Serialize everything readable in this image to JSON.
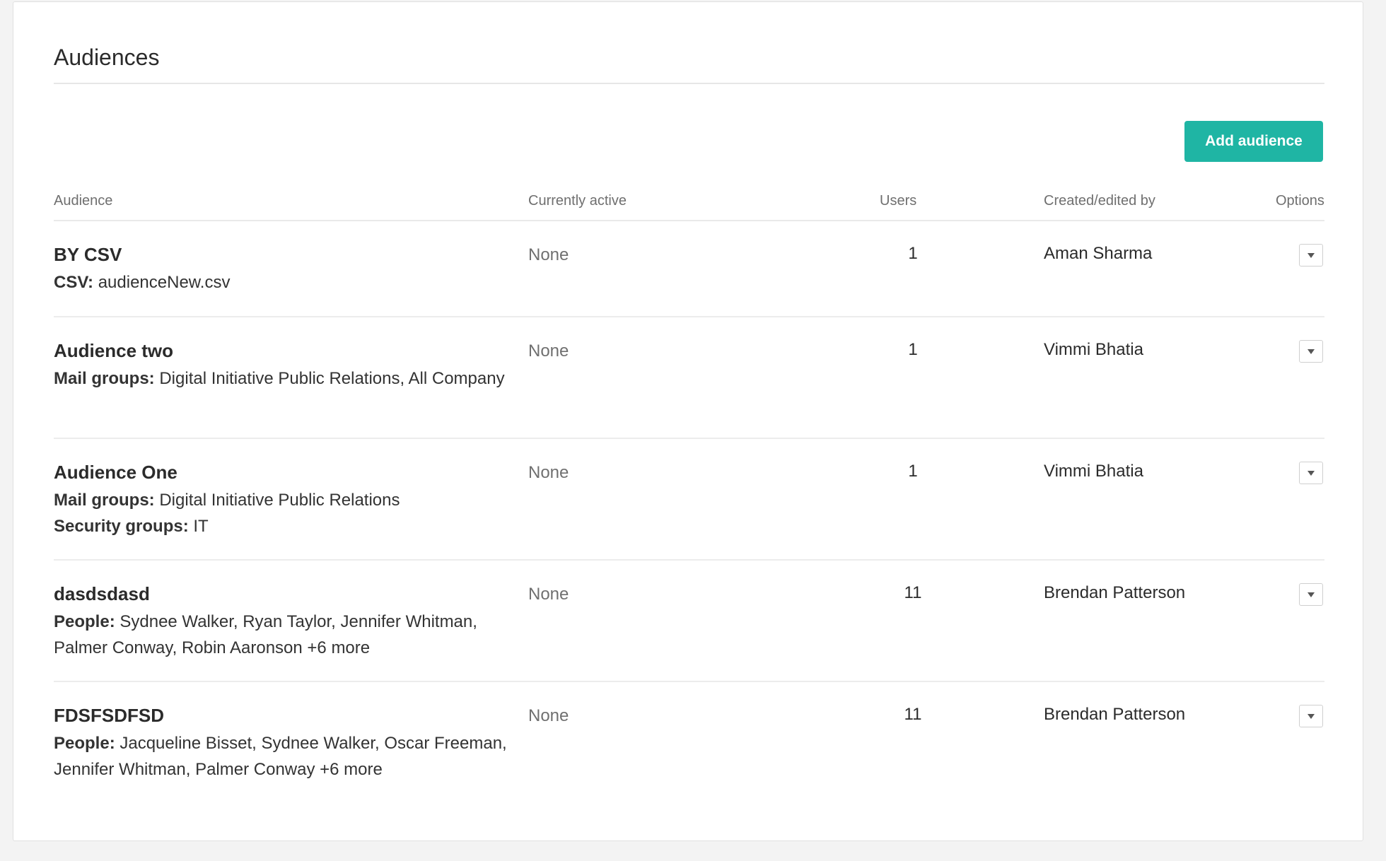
{
  "page": {
    "title": "Audiences"
  },
  "toolbar": {
    "add_label": "Add audience"
  },
  "table": {
    "headers": {
      "audience": "Audience",
      "active": "Currently active",
      "users": "Users",
      "created_by": "Created/edited by",
      "options": "Options"
    },
    "rows": [
      {
        "name": "BY CSV",
        "details": [
          {
            "label": "CSV:",
            "value": "audienceNew.csv"
          }
        ],
        "active": "None",
        "users": "1",
        "created_by": "Aman Sharma"
      },
      {
        "name": "Audience two",
        "details": [
          {
            "label": "Mail groups:",
            "value": "Digital Initiative Public Relations, All Company"
          }
        ],
        "active": "None",
        "users": "1",
        "created_by": "Vimmi Bhatia"
      },
      {
        "name": "Audience One",
        "details": [
          {
            "label": "Mail groups:",
            "value": "Digital Initiative Public Relations"
          },
          {
            "label": "Security groups:",
            "value": "IT"
          }
        ],
        "active": "None",
        "users": "1",
        "created_by": "Vimmi Bhatia"
      },
      {
        "name": "dasdsdasd",
        "details": [
          {
            "label": "People:",
            "value": "Sydnee Walker, Ryan Taylor, Jennifer Whitman, Palmer Conway, Robin Aaronson +6 more"
          }
        ],
        "active": "None",
        "users": "11",
        "created_by": "Brendan Patterson"
      },
      {
        "name": "FDSFSDFSD",
        "details": [
          {
            "label": "People:",
            "value": "Jacqueline Bisset, Sydnee Walker, Oscar Freeman, Jennifer Whitman, Palmer Conway +6 more"
          }
        ],
        "active": "None",
        "users": "11",
        "created_by": "Brendan Patterson"
      }
    ]
  },
  "colors": {
    "accent": "#1fb5a4",
    "background": "#f3f3f3",
    "card": "#ffffff"
  },
  "icons": {
    "options": "chevron-down-icon"
  }
}
